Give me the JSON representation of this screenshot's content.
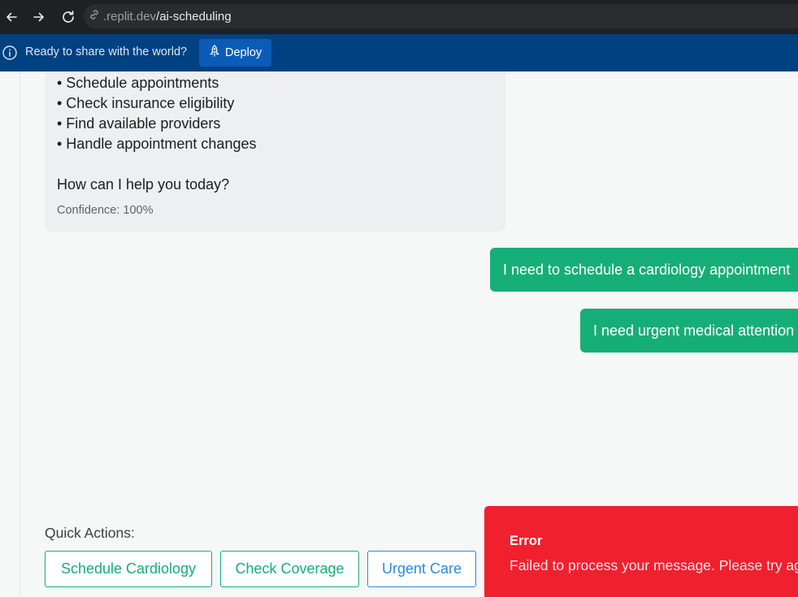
{
  "browser": {
    "url_domain": ".replit.dev",
    "url_path": "/ai-scheduling"
  },
  "banner": {
    "message": "Ready to share with the world?",
    "deploy_label": "Deploy"
  },
  "bot_message": {
    "bullets": [
      "• Schedule appointments",
      "• Check insurance eligibility",
      "• Find available providers",
      "• Handle appointment changes"
    ],
    "question": "How can I help you today?",
    "confidence": "Confidence: 100%"
  },
  "user_messages": [
    "I need to schedule a cardiology appointment",
    "I need urgent medical attention"
  ],
  "quick_actions": {
    "title": "Quick Actions:",
    "buttons": [
      "Schedule Cardiology",
      "Check Coverage",
      "Urgent Care"
    ]
  },
  "error_toast": {
    "title": "Error",
    "message": "Failed to process your message. Please try again."
  },
  "colors": {
    "accent_green": "#16ae78",
    "banner_blue": "#004182",
    "error_red": "#f0202f"
  }
}
